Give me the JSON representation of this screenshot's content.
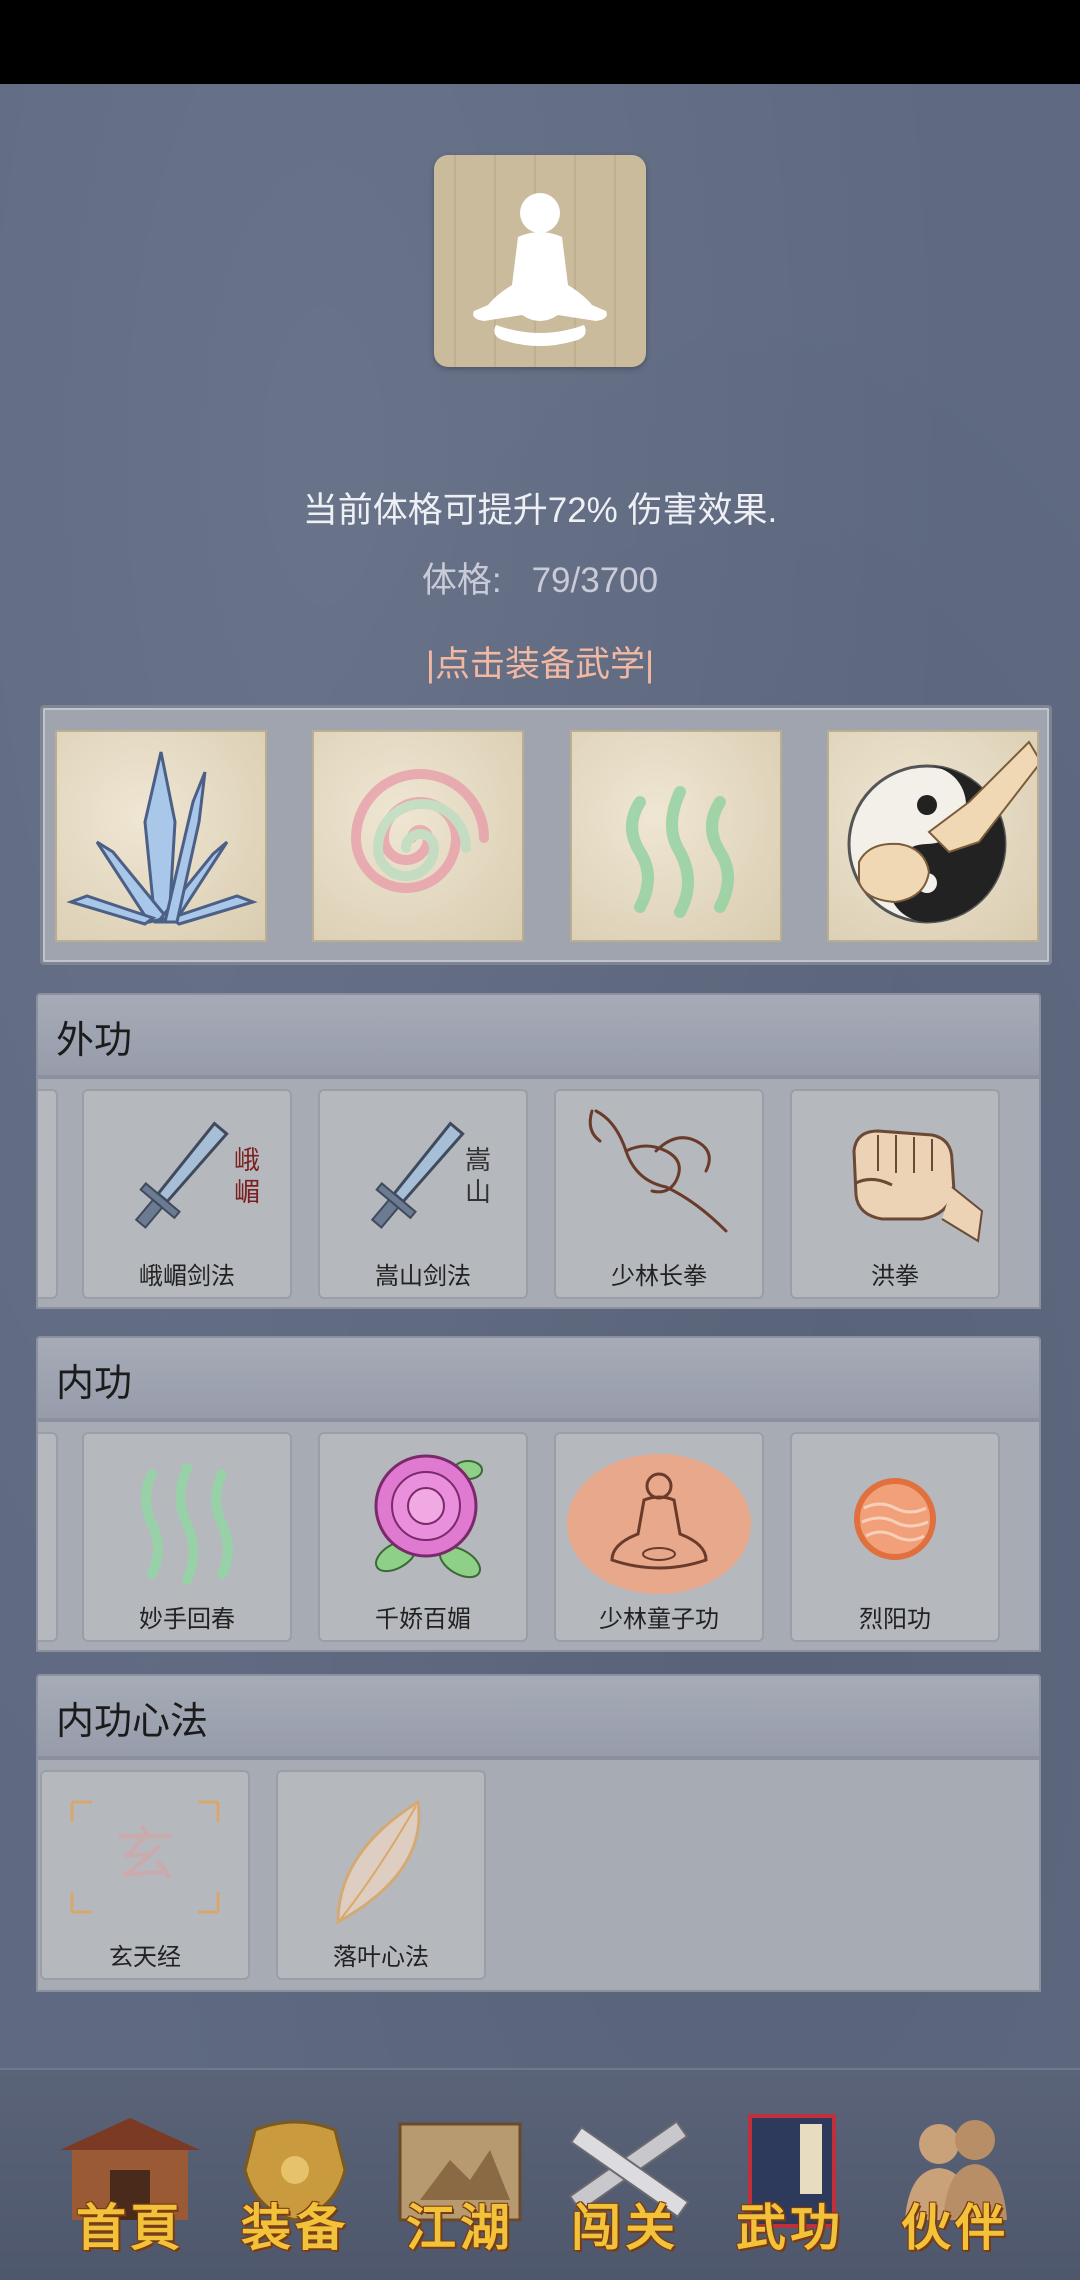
{
  "profile": {
    "effect_text": "当前体格可提升72% 伤害效果.",
    "stat_label": "体格:",
    "stat_value": "79/3700",
    "equip_link": "|点击装备武学|"
  },
  "equipped_slots": [
    {
      "icon": "crystal-blades-icon"
    },
    {
      "icon": "pink-swirl-icon"
    },
    {
      "icon": "green-waves-icon"
    },
    {
      "icon": "taiji-fist-icon"
    }
  ],
  "sections": {
    "external": {
      "title": "外功",
      "cards": [
        {
          "label": "峨嵋剑法",
          "icon": "emei-sword-icon",
          "mark": "峨\n嵋"
        },
        {
          "label": "嵩山剑法",
          "icon": "songshan-sword-icon",
          "mark": "嵩\n山"
        },
        {
          "label": "少林长拳",
          "icon": "shaolin-fist-icon"
        },
        {
          "label": "洪拳",
          "icon": "hong-fist-icon"
        }
      ]
    },
    "internal": {
      "title": "内功",
      "cards": [
        {
          "label": "妙手回春",
          "icon": "green-waves-icon"
        },
        {
          "label": "千娇百媚",
          "icon": "rose-icon"
        },
        {
          "label": "少林童子功",
          "icon": "meditating-monk-icon"
        },
        {
          "label": "烈阳功",
          "icon": "sun-orb-icon"
        }
      ]
    },
    "mind": {
      "title": "内功心法",
      "cards": [
        {
          "label": "玄天经",
          "icon": "xuan-seal-icon",
          "mark": "玄"
        },
        {
          "label": "落叶心法",
          "icon": "leaf-icon"
        }
      ]
    }
  },
  "nav": [
    {
      "label": "首頁",
      "icon": "home-pavilion-icon"
    },
    {
      "label": "装备",
      "icon": "armor-icon"
    },
    {
      "label": "江湖",
      "icon": "scroll-map-icon"
    },
    {
      "label": "闯关",
      "icon": "crossed-swords-icon"
    },
    {
      "label": "武功",
      "icon": "martial-book-icon"
    },
    {
      "label": "伙伴",
      "icon": "companions-icon"
    }
  ]
}
